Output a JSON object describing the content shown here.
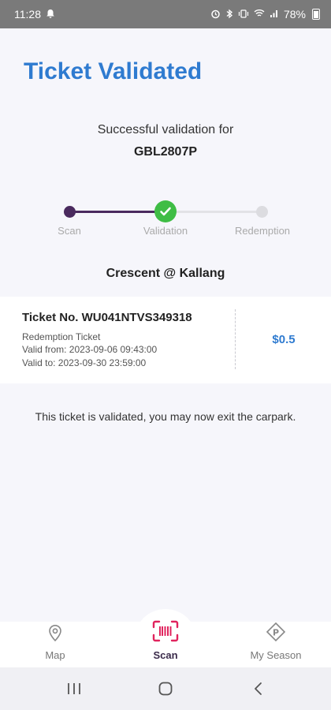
{
  "status_bar": {
    "time": "11:28",
    "battery": "78%"
  },
  "page": {
    "title": "Ticket Validated",
    "subtitle": "Successful validation for",
    "plate": "GBL2807P"
  },
  "stepper": {
    "steps": [
      {
        "label": "Scan",
        "state": "done"
      },
      {
        "label": "Validation",
        "state": "current"
      },
      {
        "label": "Redemption",
        "state": "pending"
      }
    ]
  },
  "location": "Crescent @ Kallang",
  "ticket": {
    "number": "Ticket No. WU041NTVS349318",
    "type": "Redemption Ticket",
    "valid_from": "Valid from: 2023-09-06 09:43:00",
    "valid_to": "Valid to: 2023-09-30 23:59:00",
    "price": "$0.5"
  },
  "message": "This ticket is validated, you may now exit the carpark.",
  "bottom_nav": {
    "items": [
      {
        "label": "Map",
        "icon": "map-pin-icon",
        "active": false
      },
      {
        "label": "Scan",
        "icon": "barcode-scan-icon",
        "active": true
      },
      {
        "label": "My Season",
        "icon": "parking-icon",
        "active": false
      }
    ]
  },
  "colors": {
    "accent_blue": "#2f7bd0",
    "stepper_dark": "#4a2a5e",
    "success_green": "#3fbd45",
    "scan_red": "#e0245e"
  }
}
